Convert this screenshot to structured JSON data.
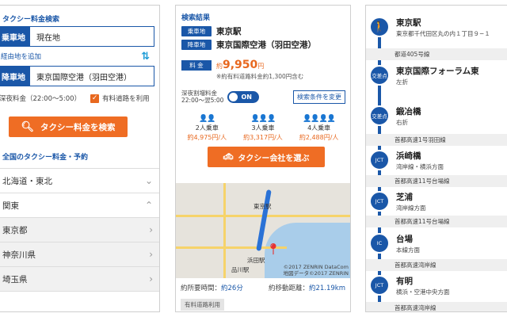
{
  "search_panel": {
    "title": "タクシー料金検索",
    "from": {
      "tag": "乗車地",
      "value": "現在地"
    },
    "via_link": "経由地を追加",
    "to": {
      "tag": "降車地",
      "value": "東京国際空港（羽田空港）"
    },
    "night_option": "深夜料金（22:00〜5:00）",
    "toll_option": "有料道路を利用",
    "search_button": "タクシー料金を検索",
    "regions_title": "全国のタクシー料金・予約",
    "regions": [
      {
        "label": "北海道・東北",
        "icon": "chevron-down"
      },
      {
        "label": "関東",
        "icon": "chevron-up"
      },
      {
        "label": "東京都",
        "icon": "chevron-right"
      },
      {
        "label": "神奈川県",
        "icon": "chevron-right"
      },
      {
        "label": "埼玉県",
        "icon": "chevron-right"
      }
    ]
  },
  "result_panel": {
    "title": "検索結果",
    "from": {
      "tag": "乗車地",
      "value": "東京駅"
    },
    "to": {
      "tag": "降車地",
      "value": "東京国際空港（羽田空港）"
    },
    "fare_tag": "料 金",
    "fare_prefix": "約",
    "fare": "9,950",
    "fare_unit": "円",
    "fare_note": "※約有料道路料金約1,300円含む",
    "night_label_1": "深夜割増料金",
    "night_label_2": "22:00〜翌5:00",
    "night_toggle": "ON",
    "condition_button": "検索条件を変更",
    "passengers": [
      {
        "icon": "👤👤",
        "count": "2人乗車",
        "amount": "約4,975円/人"
      },
      {
        "icon": "👤👤👤",
        "count": "3人乗車",
        "amount": "約3,317円/人"
      },
      {
        "icon": "👤👤👤👤",
        "count": "4人乗車",
        "amount": "約2,488円/人"
      }
    ],
    "taxi_button": "タクシー会社を選ぶ",
    "map_labels": {
      "a": "東京駅",
      "b": "浜田駅",
      "c": "品川駅"
    },
    "map_credit_1": "©2017 ZENRIN DataCom",
    "map_credit_2": "地図データ©2017 ZENRIN",
    "time_label": "約所要時間：",
    "time_value": "約26分",
    "distance_label": "約移動距離：",
    "distance_value": "約21.19km",
    "toll_tag": "有料道路利用"
  },
  "route_panel": {
    "items": [
      {
        "node": "🚶",
        "name": "東京駅",
        "sub": "東京都千代田区丸の内１丁目９−１"
      },
      {
        "node": "交差点",
        "name": "東京国際フォーラム東",
        "sub": "左折"
      },
      {
        "node": "交差点",
        "name": "鍛冶橋",
        "sub": "右折"
      },
      {
        "node": "JCT",
        "name": "浜崎橋",
        "sub": "湾岸線・横浜方面"
      },
      {
        "node": "JCT",
        "name": "芝浦",
        "sub": "湾岸線方面"
      },
      {
        "node": "IC",
        "name": "台場",
        "sub": "本線方面"
      },
      {
        "node": "JCT",
        "name": "有明",
        "sub": "横浜・空港中央方面"
      }
    ],
    "segments": [
      "都道405号線",
      "首都高速1号羽田線",
      "首都高速11号台場線",
      "首都高速11号台場線",
      "首都高速湾岸線",
      "首都高速湾岸線"
    ]
  }
}
